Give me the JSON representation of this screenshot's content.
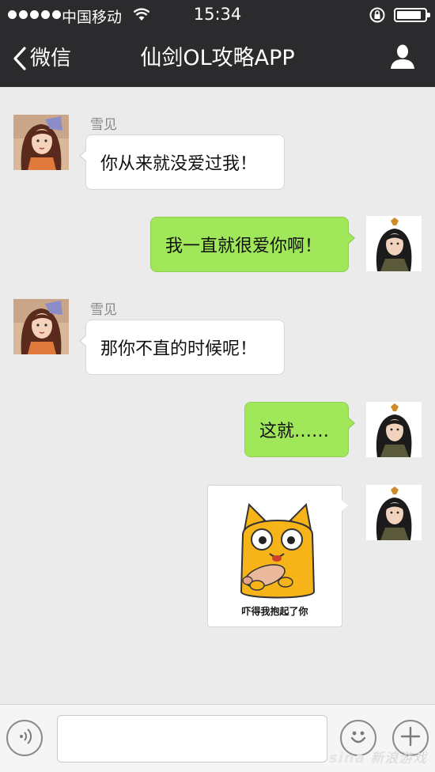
{
  "status_bar": {
    "carrier": "中国移动",
    "time": "15:34",
    "signal_dots": 5,
    "battery_level": 0.8
  },
  "nav": {
    "back_label": "微信",
    "title": "仙剑OL攻略APP"
  },
  "messages": [
    {
      "from": "other",
      "sender": "雪见",
      "text": "你从来就没爱过我！"
    },
    {
      "from": "me",
      "text": "我一直就很爱你啊！"
    },
    {
      "from": "other",
      "sender": "雪见",
      "text": "那你不直的时候呢！"
    },
    {
      "from": "me",
      "text": "这就……"
    },
    {
      "from": "me",
      "type": "sticker",
      "caption": "吓得我抱起了你"
    }
  ],
  "input": {
    "placeholder": ""
  },
  "watermark": {
    "brand": "sina",
    "text": "新浪游戏"
  },
  "colors": {
    "nav_bg": "#2b2b2d",
    "chat_bg": "#ebebeb",
    "my_bubble": "#a0e75a",
    "their_bubble": "#ffffff"
  },
  "icons": {
    "back": "chevron-left-icon",
    "profile": "person-icon",
    "voice": "voice-icon",
    "emoji": "emoji-icon",
    "add": "plus-icon"
  }
}
